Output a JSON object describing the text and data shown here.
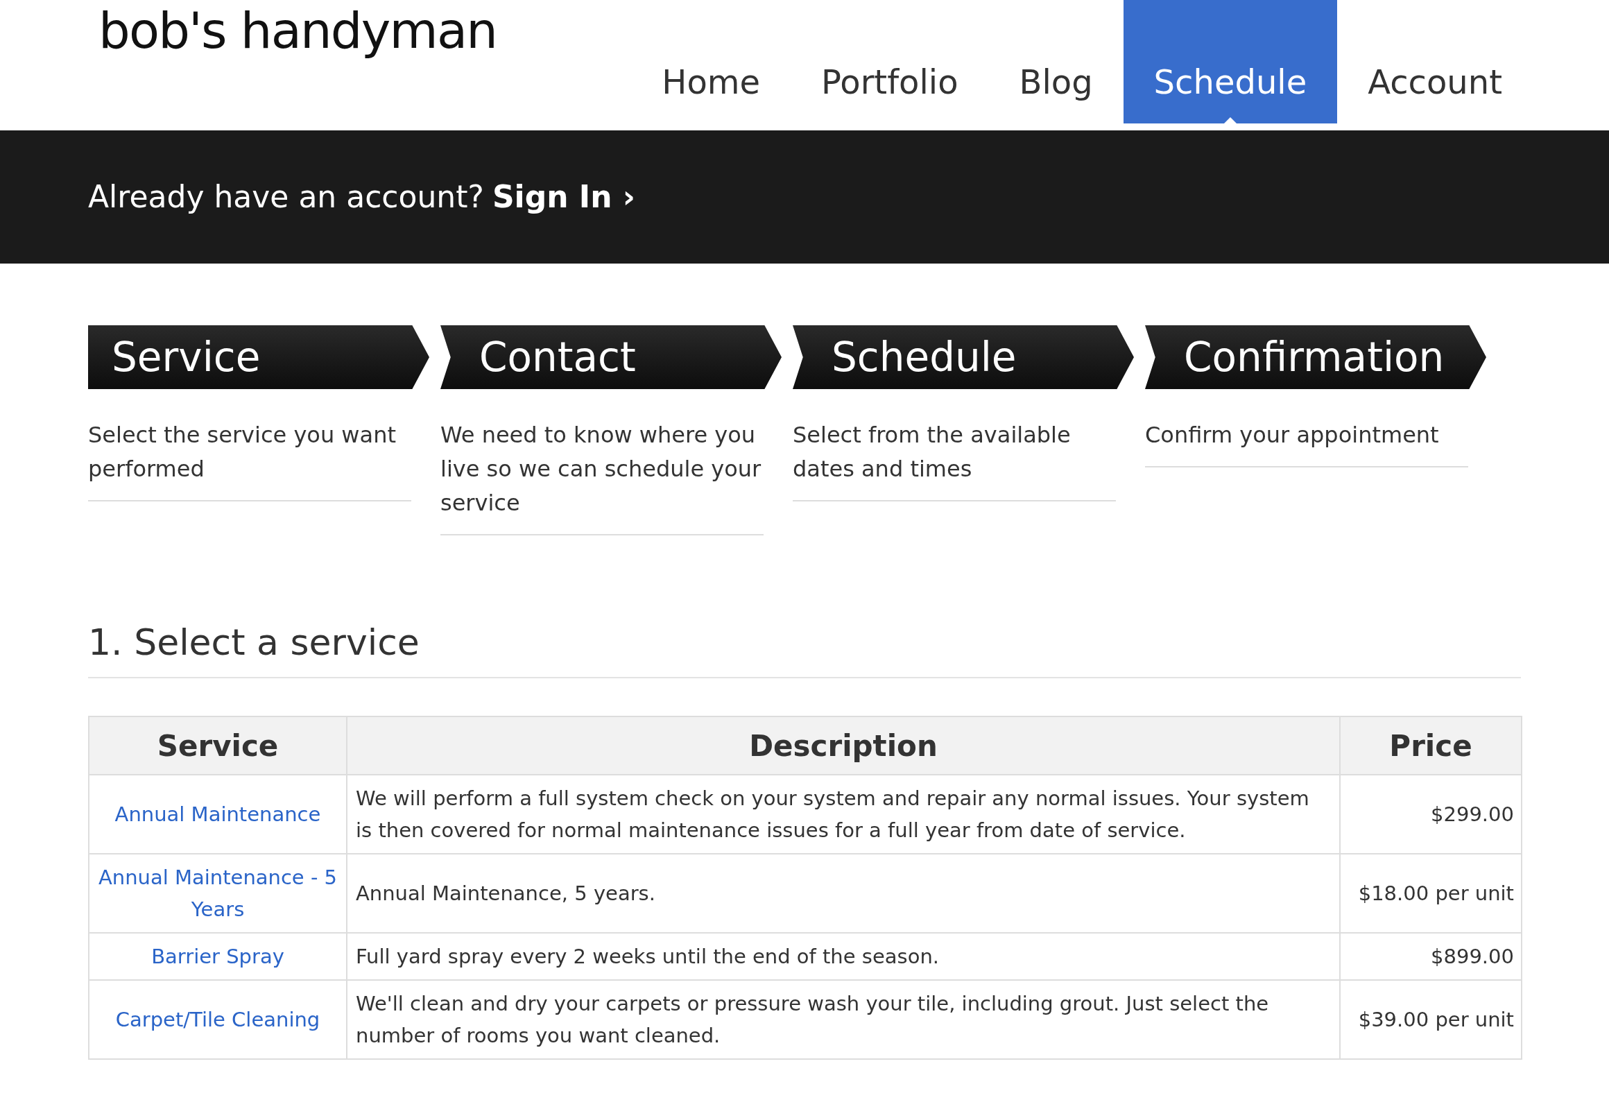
{
  "logo": "bob's handyman",
  "nav": [
    {
      "label": "Home",
      "selected": false
    },
    {
      "label": "Portfolio",
      "selected": false
    },
    {
      "label": "Blog",
      "selected": false
    },
    {
      "label": "Schedule",
      "selected": true
    },
    {
      "label": "Account",
      "selected": false
    }
  ],
  "signin_bar": {
    "text": "Already have an account?",
    "link": "Sign In ›"
  },
  "steps": [
    {
      "title": "Service",
      "description": "Select the service you want performed"
    },
    {
      "title": "Contact",
      "description": "We need to know where you live so we can schedule your service"
    },
    {
      "title": "Schedule",
      "description": "Select from the available dates and times"
    },
    {
      "title": "Confirmation",
      "description": "Confirm your appointment"
    }
  ],
  "section_title": "1. Select a service",
  "table": {
    "columns": [
      "Service",
      "Description",
      "Price"
    ],
    "rows": [
      {
        "service": "Annual Maintenance",
        "description": "We will perform a full system check on your system and repair any normal issues. Your system is then covered for normal maintenance issues for a full year from date of service.",
        "price": "$299.00"
      },
      {
        "service": "Annual Maintenance - 5 Years",
        "description": "Annual Maintenance, 5 years.",
        "price": "$18.00 per unit"
      },
      {
        "service": "Barrier Spray",
        "description": "Full yard spray every 2 weeks until the end of the season.",
        "price": "$899.00"
      },
      {
        "service": "Carpet/Tile Cleaning",
        "description": "We'll clean and dry your carpets or pressure wash your tile, including grout. Just select the number of rooms you want cleaned.",
        "price": "$39.00 per unit"
      }
    ]
  }
}
